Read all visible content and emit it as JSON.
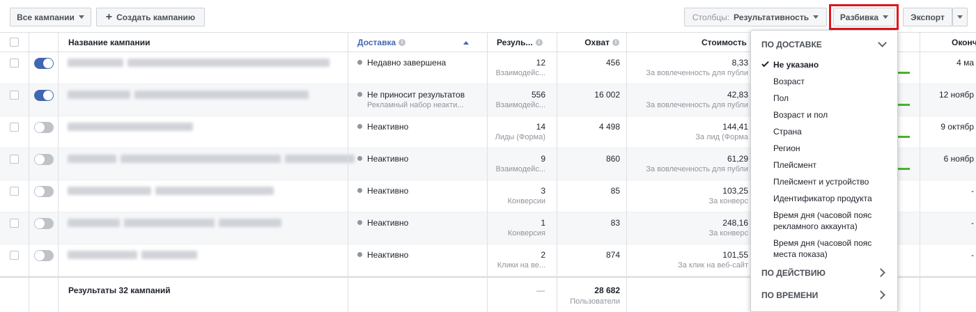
{
  "toolbar": {
    "all_campaigns": "Все кампании",
    "create_campaign": "Создать кампанию",
    "columns_label": "Столбцы:",
    "columns_value": "Результативность",
    "breakdown": "Разбивка",
    "export": "Экспорт"
  },
  "columns": {
    "name": "Название кампании",
    "delivery": "Доставка",
    "results": "Резуль...",
    "reach": "Охват",
    "cost": "Стоимость",
    "ends": "Оконч"
  },
  "rows": [
    {
      "toggle_on": true,
      "delivery": "Недавно завершена",
      "delivery_sub": "",
      "results": "12",
      "results_sub": "Взаимодейс...",
      "reach": "456",
      "cost": "8,33",
      "cost_sub": "За вовлеченность для публи",
      "ends": "4 ма",
      "ends_sub": ""
    },
    {
      "toggle_on": true,
      "delivery": "Не приносит результатов",
      "delivery_sub": "Рекламный набор неакти...",
      "results": "556",
      "results_sub": "Взаимодейс...",
      "reach": "16 002",
      "cost": "42,83",
      "cost_sub": "За вовлеченность для публи",
      "ends": "12 ноябр",
      "ends_sub": ""
    },
    {
      "toggle_on": false,
      "delivery": "Неактивно",
      "delivery_sub": "",
      "results": "14",
      "results_sub": "Лиды (Форма)",
      "reach": "4 498",
      "cost": "144,41",
      "cost_sub": "За лид (Форма",
      "ends": "9 октябр",
      "ends_sub": ""
    },
    {
      "toggle_on": false,
      "delivery": "Неактивно",
      "delivery_sub": "",
      "results": "9",
      "results_sub": "Взаимодейс...",
      "reach": "860",
      "cost": "61,29",
      "cost_sub": "За вовлеченность для публи",
      "ends": "6 ноябр",
      "ends_sub": ""
    },
    {
      "toggle_on": false,
      "delivery": "Неактивно",
      "delivery_sub": "",
      "results": "3",
      "results_sub": "Конверсии",
      "reach": "85",
      "cost": "103,25",
      "cost_sub": "За конверс",
      "ends": "-",
      "ends_sub": ""
    },
    {
      "toggle_on": false,
      "delivery": "Неактивно",
      "delivery_sub": "",
      "results": "1",
      "results_sub": "Конверсия",
      "reach": "83",
      "cost": "248,16",
      "cost_sub": "За конверс",
      "ends": "-",
      "ends_sub": ""
    },
    {
      "toggle_on": false,
      "delivery": "Неактивно",
      "delivery_sub": "",
      "results": "2",
      "results_sub": "Клики на ве...",
      "reach": "874",
      "cost": "101,55",
      "cost_sub": "За клик на веб-сайт",
      "ends": "-",
      "ends_sub": ""
    }
  ],
  "footer": {
    "summary": "Результаты 32 кампаний",
    "results": "—",
    "reach": "28 682",
    "reach_sub": "Пользователи"
  },
  "breakdown_menu": {
    "section_delivery": "ПО ДОСТАВКЕ",
    "items": [
      "Не указано",
      "Возраст",
      "Пол",
      "Возраст и пол",
      "Страна",
      "Регион",
      "Плейсмент",
      "Плейсмент и устройство",
      "Идентификатор продукта",
      "Время дня (часовой пояс рекламного аккаунта)",
      "Время дня (часовой пояс места показа)"
    ],
    "selected_index": 0,
    "section_action": "ПО ДЕЙСТВИЮ",
    "section_time": "ПО ВРЕМЕНИ"
  },
  "colors": {
    "accent": "#4267b2",
    "highlight": "#e0161d",
    "positive": "#42b72a"
  }
}
